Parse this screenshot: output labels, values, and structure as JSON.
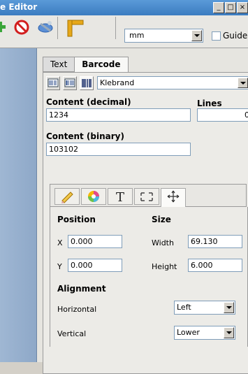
{
  "window": {
    "title": "e Editor",
    "min": "_",
    "max": "□",
    "close": "×"
  },
  "toolbar": {
    "icons": [
      "add-icon",
      "stop-icon",
      "tool-icon",
      "ruler-icon"
    ],
    "unit_value": "mm",
    "guides_label": "Guide"
  },
  "tabs": [
    {
      "label": "Text"
    },
    {
      "label": "Barcode"
    }
  ],
  "barcode": {
    "type_icons": [
      "barcode-type-1-icon",
      "barcode-type-2-icon",
      "barcode-type-3-icon"
    ],
    "symbology_value": "Klebrand",
    "content_decimal_label": "Content (decimal)",
    "content_decimal_value": "1234",
    "lines_label": "Lines",
    "lines_value": "0",
    "content_binary_label": "Content (binary)",
    "content_binary_value": "103102"
  },
  "subtabs": [
    "pencil-icon",
    "color-wheel-icon",
    "text-icon",
    "resize-icon",
    "move-icon"
  ],
  "position": {
    "label": "Position",
    "x_label": "X",
    "x_value": "0.000",
    "y_label": "Y",
    "y_value": "0.000"
  },
  "size": {
    "label": "Size",
    "width_label": "Width",
    "width_value": "69.130",
    "height_label": "Height",
    "height_value": "6.000"
  },
  "alignment": {
    "label": "Alignment",
    "horizontal_label": "Horizontal",
    "horizontal_value": "Left",
    "vertical_label": "Vertical",
    "vertical_value": "Lower"
  }
}
